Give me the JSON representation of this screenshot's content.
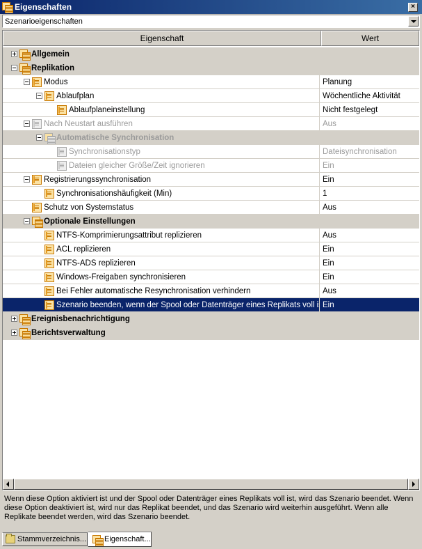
{
  "window": {
    "title": "Eigenschaften",
    "close_glyph": "×"
  },
  "selector": {
    "value": "Szenarioeigenschaften"
  },
  "grid": {
    "header": {
      "property": "Eigenschaft",
      "value": "Wert"
    },
    "rows": [
      {
        "label": "Allgemein",
        "value": "",
        "level": 0,
        "kind": "group",
        "expander": "plus",
        "icon": "stack-icon",
        "disabled": false,
        "selected": false
      },
      {
        "label": "Replikation",
        "value": "",
        "level": 0,
        "kind": "group",
        "expander": "minus",
        "icon": "stack-icon",
        "disabled": false,
        "selected": false
      },
      {
        "label": "Modus",
        "value": "Planung",
        "level": 1,
        "kind": "item",
        "expander": "minus",
        "icon": "property-icon",
        "disabled": false,
        "selected": false
      },
      {
        "label": "Ablaufplan",
        "value": "Wöchentliche Aktivität",
        "level": 2,
        "kind": "item",
        "expander": "minus",
        "icon": "property-icon",
        "disabled": false,
        "selected": false
      },
      {
        "label": "Ablaufplaneinstellung",
        "value": "Nicht festgelegt",
        "level": 3,
        "kind": "item",
        "expander": "",
        "icon": "property-icon",
        "disabled": false,
        "selected": false
      },
      {
        "label": "Nach Neustart ausführen",
        "value": "Aus",
        "level": 1,
        "kind": "item",
        "expander": "minus",
        "icon": "property-icon",
        "disabled": true,
        "selected": false
      },
      {
        "label": "Automatische Synchronisation",
        "value": "",
        "level": 2,
        "kind": "group",
        "expander": "minus",
        "icon": "stack-icon",
        "disabled": true,
        "selected": false
      },
      {
        "label": "Synchronisationstyp",
        "value": "Dateisynchronisation",
        "level": 3,
        "kind": "item",
        "expander": "",
        "icon": "property-icon",
        "disabled": true,
        "selected": false
      },
      {
        "label": "Dateien gleicher Größe/Zeit ignorieren",
        "value": "Ein",
        "level": 3,
        "kind": "item",
        "expander": "",
        "icon": "property-icon",
        "disabled": true,
        "selected": false
      },
      {
        "label": "Registrierungssynchronisation",
        "value": "Ein",
        "level": 1,
        "kind": "item",
        "expander": "minus",
        "icon": "property-icon",
        "disabled": false,
        "selected": false
      },
      {
        "label": "Synchronisationshäufigkeit (Min)",
        "value": "1",
        "level": 2,
        "kind": "item",
        "expander": "",
        "icon": "property-icon",
        "disabled": false,
        "selected": false
      },
      {
        "label": "Schutz von Systemstatus",
        "value": "Aus",
        "level": 1,
        "kind": "item",
        "expander": "",
        "icon": "property-icon",
        "disabled": false,
        "selected": false
      },
      {
        "label": "Optionale Einstellungen",
        "value": "",
        "level": 1,
        "kind": "group",
        "expander": "minus",
        "icon": "stack-icon",
        "disabled": false,
        "selected": false
      },
      {
        "label": "NTFS-Komprimierungsattribut replizieren",
        "value": "Aus",
        "level": 2,
        "kind": "item",
        "expander": "",
        "icon": "property-icon",
        "disabled": false,
        "selected": false
      },
      {
        "label": "ACL replizieren",
        "value": "Ein",
        "level": 2,
        "kind": "item",
        "expander": "",
        "icon": "property-icon",
        "disabled": false,
        "selected": false
      },
      {
        "label": "NTFS-ADS replizieren",
        "value": "Ein",
        "level": 2,
        "kind": "item",
        "expander": "",
        "icon": "property-icon",
        "disabled": false,
        "selected": false
      },
      {
        "label": "Windows-Freigaben synchronisieren",
        "value": "Ein",
        "level": 2,
        "kind": "item",
        "expander": "",
        "icon": "property-icon",
        "disabled": false,
        "selected": false
      },
      {
        "label": "Bei Fehler automatische Resynchronisation verhindern",
        "value": "Aus",
        "level": 2,
        "kind": "item",
        "expander": "",
        "icon": "property-icon",
        "disabled": false,
        "selected": false
      },
      {
        "label": "Szenario beenden, wenn der Spool oder Datenträger eines Replikats voll ist",
        "value": "Ein",
        "level": 2,
        "kind": "item",
        "expander": "",
        "icon": "property-icon",
        "disabled": false,
        "selected": true
      },
      {
        "label": "Ereignisbenachrichtigung",
        "value": "",
        "level": 0,
        "kind": "group",
        "expander": "plus",
        "icon": "stack-icon",
        "disabled": false,
        "selected": false
      },
      {
        "label": "Berichtsverwaltung",
        "value": "",
        "level": 0,
        "kind": "group",
        "expander": "plus",
        "icon": "stack-icon",
        "disabled": false,
        "selected": false
      }
    ]
  },
  "description": "Wenn diese Option aktiviert ist und der Spool oder Datenträger eines Replikats voll ist, wird das Szenario beendet. Wenn diese Option deaktiviert ist, wird nur das Replikat beendet, und das Szenario wird weiterhin ausgeführt. Wenn alle Replikate beendet werden, wird das Szenario beendet.",
  "tabs": [
    {
      "label": "Stammverzeichnis...",
      "icon": "folder-icon",
      "active": false
    },
    {
      "label": "Eigenschaft...",
      "icon": "properties-icon",
      "active": true
    }
  ],
  "colors": {
    "selection": "#0a246a",
    "group_background": "#d4d0c8",
    "disabled_text": "#9a9a9a"
  }
}
